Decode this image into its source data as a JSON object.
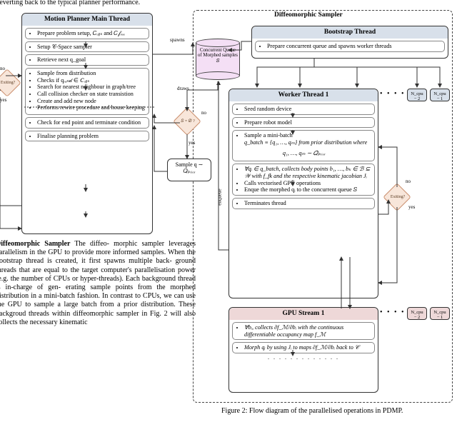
{
  "toptext": "reverting back to the typical planner performance.",
  "diagram": {
    "diffeo_title": "Diffeomorphic Sampler",
    "planner": {
      "title": "Motion Planner Main Thread",
      "i1": "Prepare problem setup, 𝐶ₒᵦₛ and 𝐶𝒻ᵣₑₑ",
      "i2": "Setup 𝒞-Space sampler",
      "i3": "Retrieve next q_goal",
      "i4a": "Sample from distribution",
      "i4b": "Checks if qᵣₐₙ𝒹 ∈ 𝐶ₒᵦₛ",
      "i4c": "Search for nearest neighbour in graph/tree",
      "i4d": "Call collision checker on state transistion",
      "i4e": "Create and add new node",
      "i4f": "Performs rewire procedure and house keeping",
      "i5": "Check for end point and terminate condition",
      "i6": "Finalise planning problem"
    },
    "cylinder": "Concurrent Queue of Morphed samples 𝑆",
    "decision_s": "𝑆 = ∅ ?",
    "sample_box": "Sample q ∼ 𝑄ₚᵣᵢₒᵣ",
    "exiting_left": "Exiting?",
    "exiting_right": "Exiting?",
    "bootstrap": {
      "title": "Bootstrap Thread",
      "i1": "Prepare concurrent queue and spawns worker threads"
    },
    "worker": {
      "title": "Worker Thread 1",
      "w1": "Seed random device",
      "w2": "Prepare robot model",
      "w3a": "Sample a mini-batch",
      "w3b": "q_batch ≡ {q₁, …, qₘ} from prior distribution where",
      "w3c": "q₁, …, qₘ ∼ 𝑄ₚᵣᵢₒᵣ",
      "w4a": "∀qᵢ ∈ q_batch, collects body points b₁, …, bₖ ∈ ℬ ⊆ 𝒲 with f_fk and the respective kinematic jacobian Jᵢ",
      "w4b": "Calls vectorised GPU operations",
      "w4c": "Enque the morphed qᵢ to the concurrent queue 𝑆",
      "w5": "Terminates thread"
    },
    "gpu": {
      "title": "GPU Stream 1",
      "g1": "∀bᵢ, collects ∂f_ℳ/∂bᵢ with the continuous differentiable occupancy map f_ℳ",
      "g2": "Morph qᵢ by using Jᵢ to maps ∂f_ℳ/∂bᵢ back to 𝒞"
    },
    "stub_a": "N_cpu − 2",
    "stub_b": "N_cpu − 1",
    "labels": {
      "spawns": "spawns",
      "draws": "draws",
      "enqueue": "enqueue",
      "yes": "yes",
      "no": "no"
    }
  },
  "leftcol": {
    "h": "Diffeomorphic Sampler",
    "body": "   The diffeo- morphic sampler leverages parallelism in the GPU to provide more informed samples. When the bootstrap thread is created, it first spawns multiple back- ground threads that are equal to the target computer's parallelisation power (e.g. the number of CPUs or hyper-threads). Each background thread is in-charge of gen- erating sample points from the morphed distribution in a mini-batch fashion. In contrast to CPUs, we can use the GPU to sample a large batch from a prior distribution. These backgroud threads within diffeomorphic sampler in Fig. 2 will also collects the necessary kinematic"
  },
  "caption": "Figure 2: Flow diagram of the parallelised operations in PDMP."
}
